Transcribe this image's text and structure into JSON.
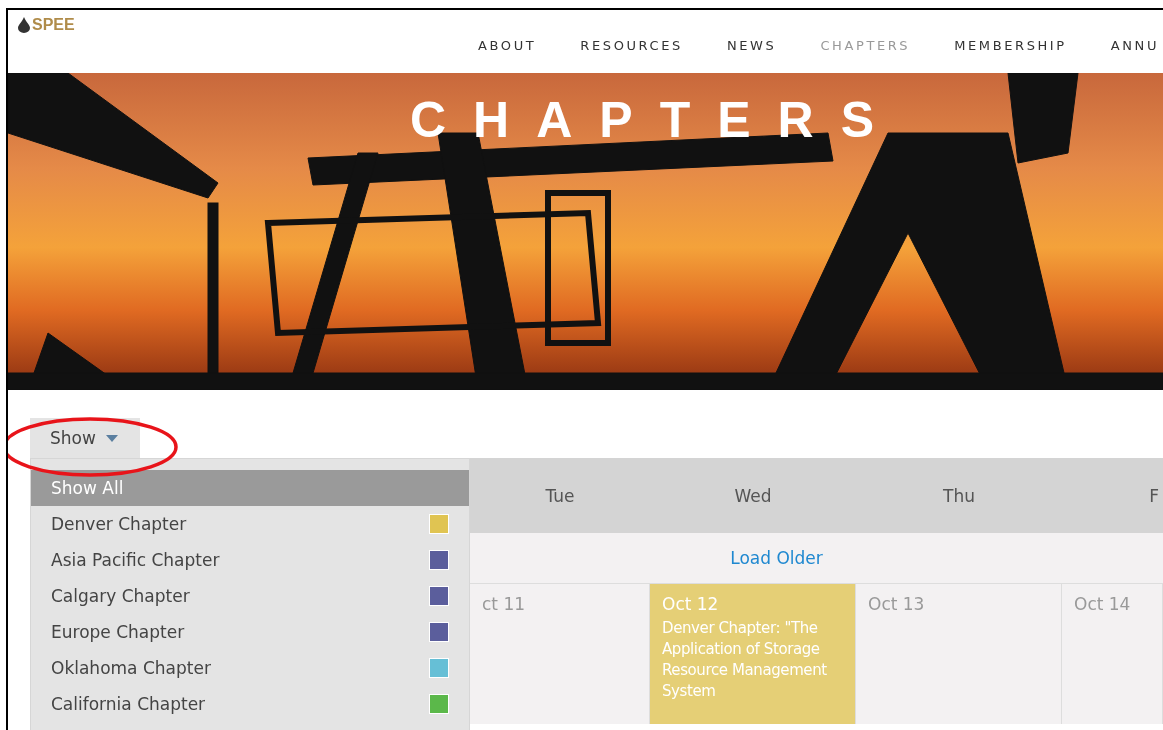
{
  "header": {
    "logo": "SPEE",
    "nav": [
      {
        "label": "ABOUT",
        "selected": false
      },
      {
        "label": "RESOURCES",
        "selected": false
      },
      {
        "label": "NEWS",
        "selected": false
      },
      {
        "label": "CHAPTERS",
        "selected": true
      },
      {
        "label": "MEMBERSHIP",
        "selected": false
      },
      {
        "label": "ANNU",
        "selected": false
      }
    ]
  },
  "hero": {
    "title": "CHAPTERS"
  },
  "filter": {
    "button": "Show",
    "expanded": true,
    "options": [
      {
        "label": "Show All",
        "selected": true
      },
      {
        "label": "Denver Chapter",
        "selected": false,
        "color": "#e0c452"
      },
      {
        "label": "Asia Pacific Chapter",
        "selected": false,
        "color": "#5b5e9c"
      },
      {
        "label": "Calgary Chapter",
        "selected": false,
        "color": "#5b5e9c"
      },
      {
        "label": "Europe Chapter",
        "selected": false,
        "color": "#5b5e9c"
      },
      {
        "label": "Oklahoma Chapter",
        "selected": false,
        "color": "#66bfd6"
      },
      {
        "label": "California Chapter",
        "selected": false,
        "color": "#5bb84a"
      }
    ]
  },
  "calendar": {
    "days": [
      "Tue",
      "Wed",
      "Thu",
      "F"
    ],
    "load_older": "Load Older",
    "cells": [
      {
        "date": "ct 11"
      },
      {
        "date": "Oct 12",
        "color": "#e5cf76",
        "events": [
          "Denver Chapter: \"The Application of Storage Resource Management System"
        ]
      },
      {
        "date": "Oct 13"
      },
      {
        "date": "Oct 14"
      }
    ]
  }
}
